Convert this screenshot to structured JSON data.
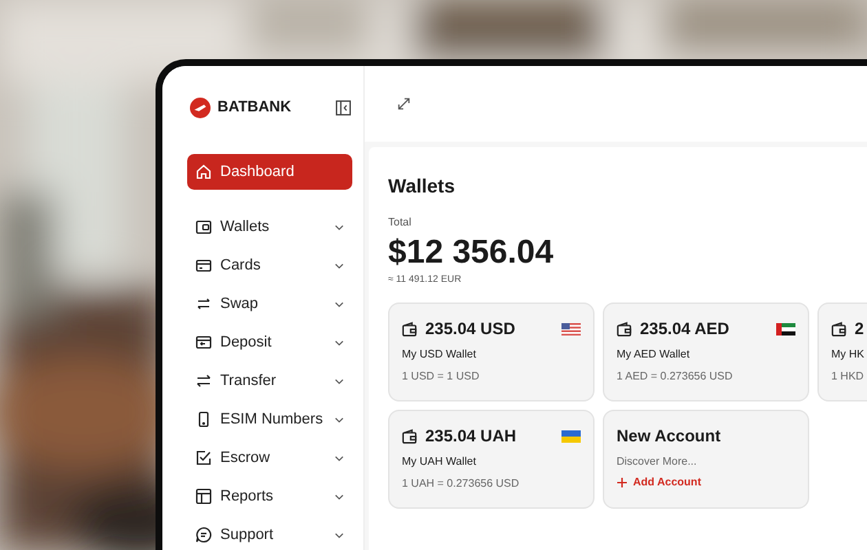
{
  "brand": "BATBANK",
  "sidebar": {
    "items": [
      {
        "label": "Dashboard",
        "selected": true
      },
      {
        "label": "Wallets",
        "selected": false
      },
      {
        "label": "Cards",
        "selected": false
      },
      {
        "label": "Swap",
        "selected": false
      },
      {
        "label": "Deposit",
        "selected": false
      },
      {
        "label": "Transfer",
        "selected": false
      },
      {
        "label": "ESIM Numbers",
        "selected": false
      },
      {
        "label": "Escrow",
        "selected": false
      },
      {
        "label": "Reports",
        "selected": false
      },
      {
        "label": "Support",
        "selected": false
      }
    ]
  },
  "wallets": {
    "title": "Wallets",
    "total_label": "Total",
    "total": "$12 356.04",
    "total_converted": "≈ 11 491.12 EUR",
    "accounts": [
      {
        "kind": "wallet",
        "amount": "235.04 USD",
        "name": "My USD Wallet",
        "rate": "1 USD = 1 USD"
      },
      {
        "kind": "wallet",
        "amount": "235.04 AED",
        "name": "My AED Wallet",
        "rate": "1 AED = 0.273656 USD"
      },
      {
        "kind": "wallet",
        "amount": "2",
        "name": "My HK",
        "rate": "1 HKD"
      },
      {
        "kind": "wallet",
        "amount": "235.04 UAH",
        "name": "My UAH Wallet",
        "rate": "1 UAH = 0.273656 USD"
      },
      {
        "kind": "new",
        "title": "New Account",
        "subtitle": "Discover More...",
        "action": "Add Account"
      }
    ]
  }
}
